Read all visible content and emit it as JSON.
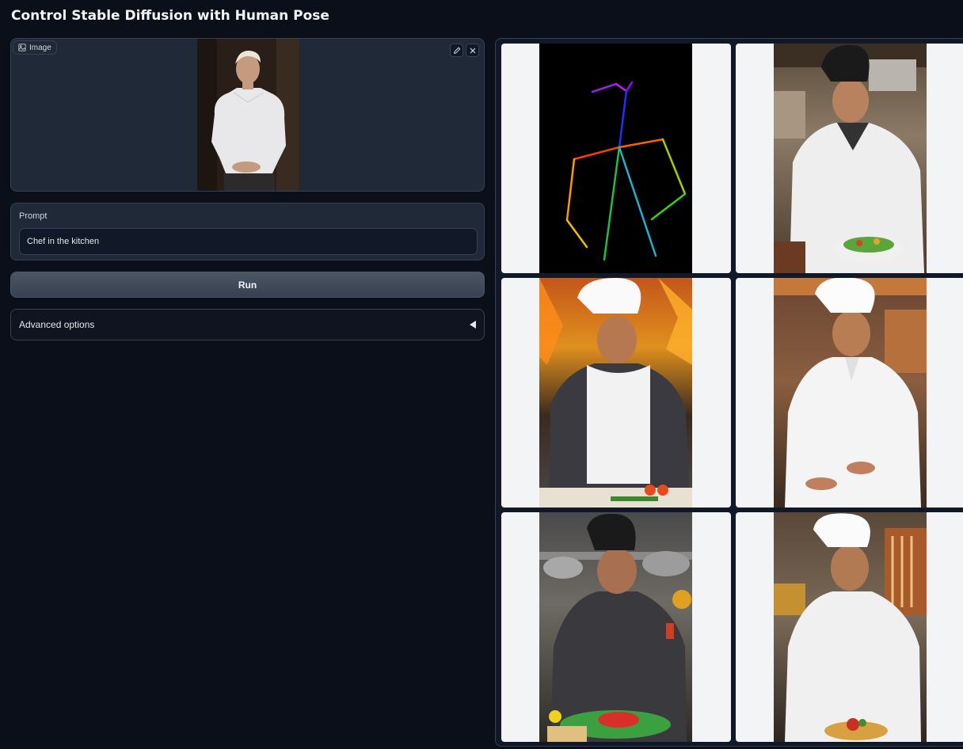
{
  "app": {
    "title": "Control Stable Diffusion with Human Pose"
  },
  "image_input": {
    "label": "Image",
    "edit_icon": "pencil-icon",
    "clear_icon": "close-icon"
  },
  "prompt": {
    "label": "Prompt",
    "value": "Chef in the kitchen",
    "placeholder": ""
  },
  "run_button": {
    "label": "Run"
  },
  "advanced_options": {
    "label": "Advanced options",
    "icon": "triangle-left-icon"
  },
  "gallery": {
    "items": [
      {
        "kind": "pose-skeleton"
      },
      {
        "kind": "chef-photo",
        "hat": "black",
        "jacket": "white",
        "background": "kitchen-steel"
      },
      {
        "kind": "chef-photo",
        "hat": "white",
        "jacket": "dark-shirt-white-apron",
        "background": "fire"
      },
      {
        "kind": "chef-photo",
        "hat": "white",
        "jacket": "white",
        "background": "kitchen-warm"
      },
      {
        "kind": "chef-photo",
        "hat": "black",
        "jacket": "black",
        "background": "kitchen-steel"
      },
      {
        "kind": "chef-photo",
        "hat": "white",
        "jacket": "white",
        "background": "kitchen-warm"
      }
    ]
  },
  "colors": {
    "page_bg": "#0b0f19",
    "panel_bg": "#1f2937",
    "border": "#374151",
    "gallery_cell_bg": "#f3f4f6"
  }
}
